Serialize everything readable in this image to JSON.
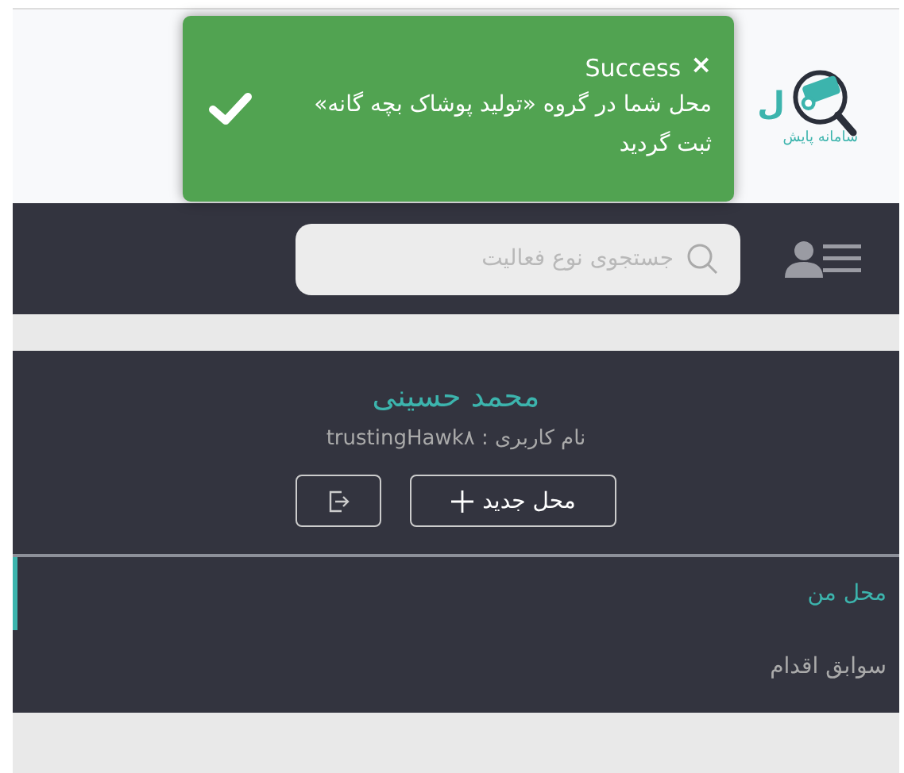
{
  "toast": {
    "kind": "success",
    "title": "Success",
    "close": "×",
    "message": "محل شما در گروه «تولید پوشاک بچه گانه» ثبت گردید"
  },
  "header": {
    "logo_letter": "ل",
    "logo_subtitle": "سامانه پایش"
  },
  "navbar": {
    "search": {
      "placeholder": "جستجوی نوع فعالیت"
    }
  },
  "profile": {
    "name": "محمد حسینی",
    "username": "نام کاربری : trustingHawk۸",
    "new_button": "محل جدید"
  },
  "menu": [
    {
      "label": "محل من",
      "selected": true
    },
    {
      "label": "سوابق اقدام",
      "selected": false
    }
  ]
}
